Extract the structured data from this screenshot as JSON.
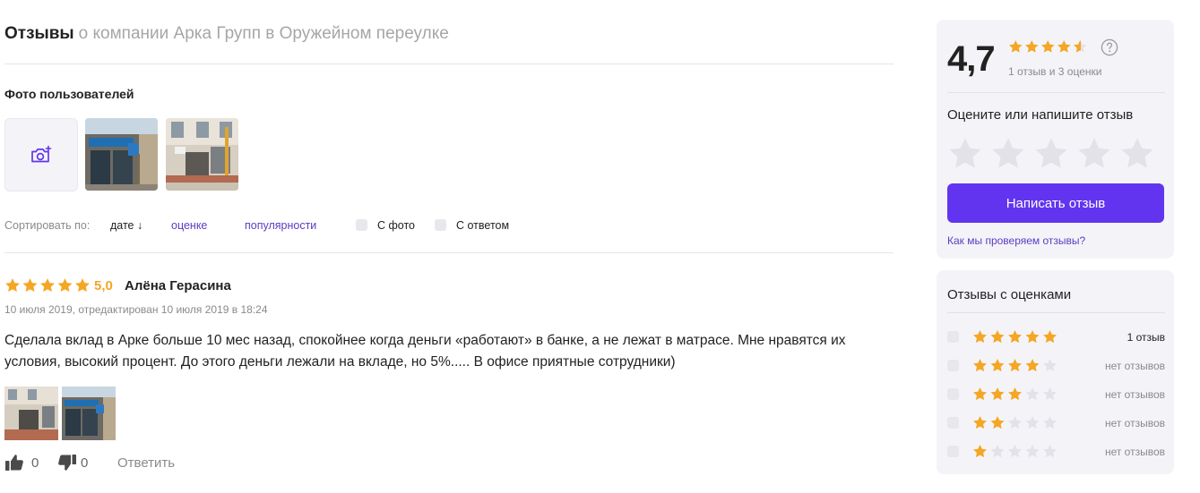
{
  "header": {
    "title_strong": "Отзывы",
    "title_muted": "о компании Арка Групп в Оружейном переулке"
  },
  "photos": {
    "title": "Фото пользователей",
    "add_icon": "camera-plus-icon"
  },
  "sort": {
    "label": "Сортировать по:",
    "options": [
      {
        "label": "дате ↓",
        "active": true
      },
      {
        "label": "оценке",
        "active": false
      },
      {
        "label": "популярности",
        "active": false
      }
    ],
    "filters": [
      {
        "label": "С фото",
        "checked": false
      },
      {
        "label": "С ответом",
        "checked": false
      }
    ]
  },
  "review": {
    "rating": 5,
    "score": "5,0",
    "author": "Алёна Герасина",
    "date": "10 июля 2019, отредактирован 10 июля 2019 в 18:24",
    "text": "Сделала вклад в Арке больше 10 мес назад, спокойнее когда деньги «работают» в банке, а не лежат в матрасе. Мне нравятся их условия, высокий процент. До этого деньги лежали на вкладе, но 5%..... В офисе приятные сотрудники)",
    "likes": "0",
    "dislikes": "0",
    "reply": "Ответить"
  },
  "summary": {
    "rating": "4,7",
    "stars_value": 4.7,
    "count_text": "1 отзыв и 3 оценки",
    "prompt": "Оцените или напишите отзыв",
    "button": "Написать отзыв",
    "link": "Как мы проверяем отзывы?"
  },
  "filter_by_rating": {
    "title": "Отзывы с оценками",
    "rows": [
      {
        "stars": 5,
        "count": "1 отзыв"
      },
      {
        "stars": 4,
        "count": "нет отзывов"
      },
      {
        "stars": 3,
        "count": "нет отзывов"
      },
      {
        "stars": 2,
        "count": "нет отзывов"
      },
      {
        "stars": 1,
        "count": "нет отзывов"
      }
    ]
  },
  "colors": {
    "accent": "#6234f0",
    "link": "#5b3cc4",
    "star": "#f5a623",
    "star_empty": "#e2e2e8"
  }
}
